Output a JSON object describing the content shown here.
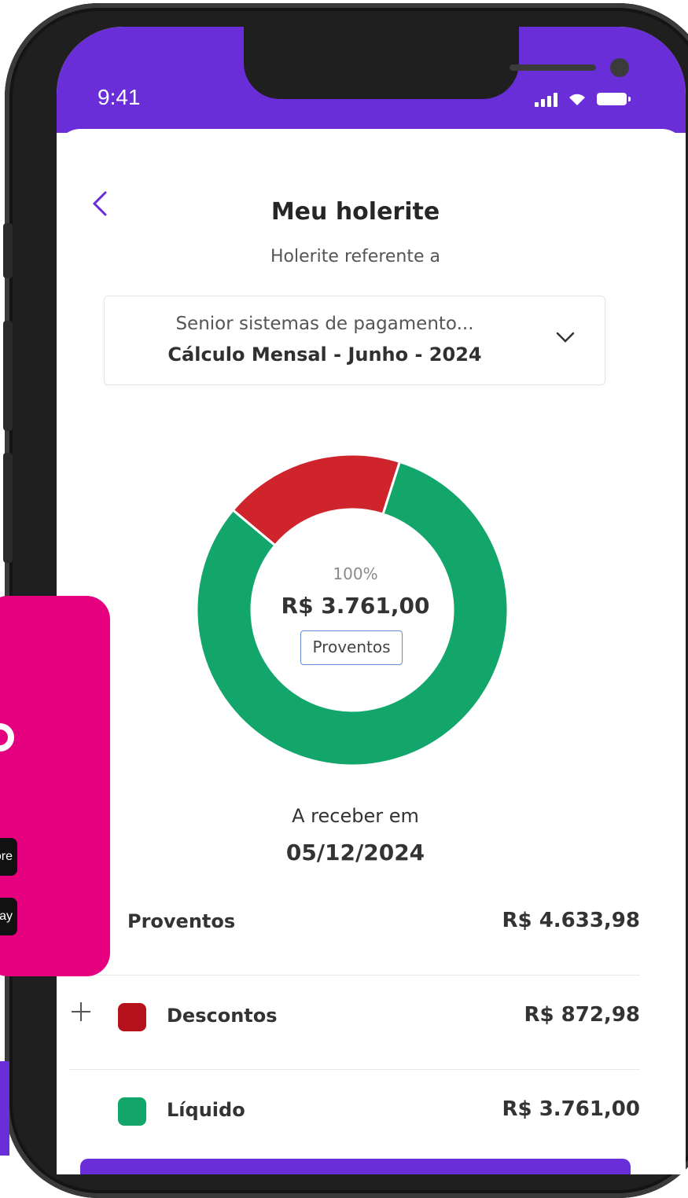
{
  "status_bar": {
    "time": "9:41"
  },
  "header": {
    "title": "Meu holerite",
    "subtitle": "Holerite referente a"
  },
  "selector": {
    "company": "Senior sistemas de pagamento...",
    "period": "Cálculo Mensal - Junho - 2024"
  },
  "chart_data": {
    "type": "pie",
    "style": "donut",
    "slices": [
      {
        "label": "Descontos",
        "value": 872.98,
        "color": "#d0242d"
      },
      {
        "label": "Líquido",
        "value": 3761.0,
        "color": "#12a66b"
      }
    ],
    "center": {
      "percent": "100%",
      "value": "R$ 3.761,00",
      "tag": "Proventos"
    }
  },
  "payment": {
    "label": "A receber em",
    "date": "05/12/2024"
  },
  "summary": {
    "proventos": {
      "label": "Proventos",
      "value": "R$ 4.633,98"
    },
    "descontos": {
      "label": "Descontos",
      "value": "R$ 872,98",
      "color": "#b5121b"
    },
    "liquido": {
      "label": "Líquido",
      "value": "R$ 3.761,00",
      "color": "#12a66b"
    }
  },
  "promo": {
    "badge_app_store": "ore",
    "badge_google_play": "Play",
    "color": "#e5007f"
  },
  "colors": {
    "primary": "#6a2ed8"
  }
}
